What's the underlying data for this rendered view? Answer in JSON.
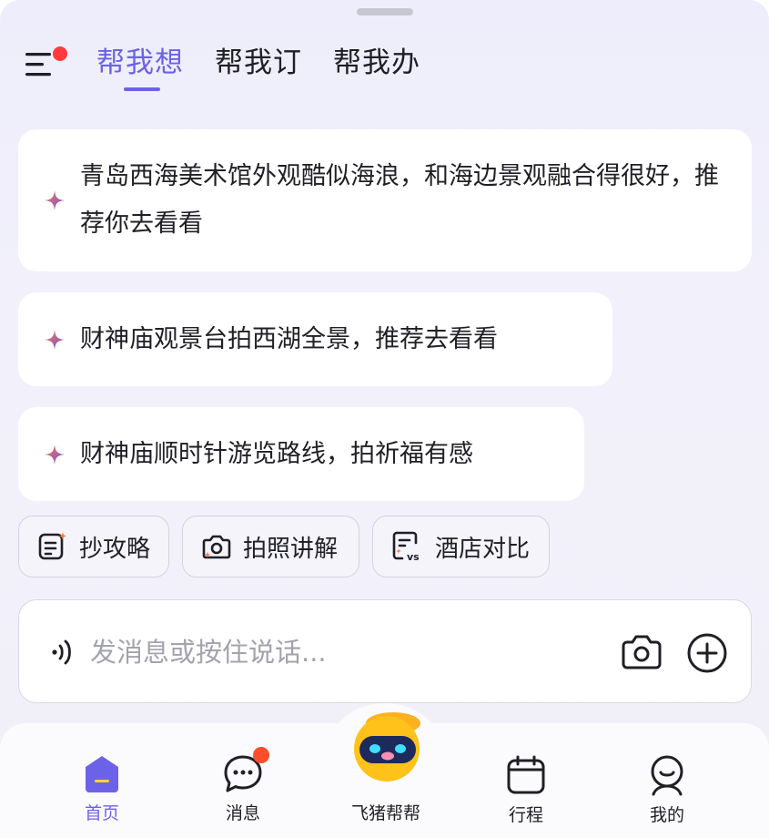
{
  "header": {
    "tabs": [
      {
        "label": "帮我想",
        "active": true
      },
      {
        "label": "帮我订",
        "active": false
      },
      {
        "label": "帮我办",
        "active": false
      }
    ]
  },
  "suggestions": [
    {
      "text": "青岛西海美术馆外观酷似海浪，和海边景观融合得很好，推荐你去看看"
    },
    {
      "text": "财神庙观景台拍西湖全景，推荐去看看"
    },
    {
      "text": "财神庙顺时针游览路线，拍祈福有感"
    }
  ],
  "quick_actions": [
    {
      "label": "抄攻略",
      "icon": "note-sparkle-icon"
    },
    {
      "label": "拍照讲解",
      "icon": "camera-sparkle-icon"
    },
    {
      "label": "酒店对比",
      "icon": "compare-vs-icon"
    }
  ],
  "composer": {
    "placeholder": "发消息或按住说话..."
  },
  "bottom_nav": [
    {
      "label": "首页",
      "icon": "home-icon",
      "active": true
    },
    {
      "label": "消息",
      "icon": "chat-bubble-icon",
      "badge": true
    },
    {
      "label": "飞猪帮帮",
      "icon": "mascot-icon"
    },
    {
      "label": "行程",
      "icon": "calendar-icon"
    },
    {
      "label": "我的",
      "icon": "profile-icon"
    }
  ],
  "colors": {
    "accent": "#6c62ea",
    "badge": "#ff3b3b",
    "text": "#1f1f26",
    "placeholder": "#a3a3ad",
    "background": "#eeedfb"
  }
}
